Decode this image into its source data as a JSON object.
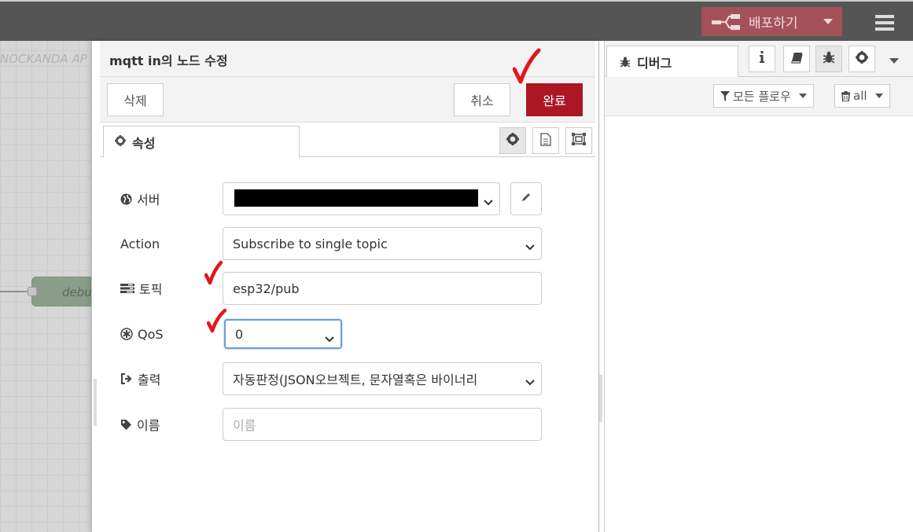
{
  "header": {
    "deploy_label": "배포하기"
  },
  "workspace": {
    "flow_tab_label": "NOCKANDA AP",
    "node_label": "debu"
  },
  "editor": {
    "title": "mqtt in의 노드 수정",
    "delete_label": "삭제",
    "cancel_label": "취소",
    "done_label": "완료",
    "tab_properties": "속성",
    "fields": {
      "server": {
        "label": "서버"
      },
      "action": {
        "label": "Action",
        "value": "Subscribe to single topic"
      },
      "topic": {
        "label": "토픽",
        "value": "esp32/pub"
      },
      "qos": {
        "label": "QoS",
        "value": "0"
      },
      "output": {
        "label": "출력",
        "value": "자동판정(JSON오브젝트, 문자열혹은 바이너리"
      },
      "name": {
        "label": "이름",
        "placeholder": "이름"
      }
    }
  },
  "sidebar": {
    "debug_tab": "디버그",
    "filter_flows": "모든 플로우",
    "clear_all": "all"
  },
  "colors": {
    "header_bg": "#555555",
    "deploy_bg": "#a3525a",
    "done_bg": "#ad1625",
    "annotation_check": "#e3161c"
  },
  "icons": [
    "deploy-icon",
    "hamburger-menu-icon",
    "cog-icon",
    "document-icon",
    "frame-icon",
    "globe-icon",
    "pencil-icon",
    "tasks-icon",
    "asterisk-icon",
    "sign-out-icon",
    "tag-icon",
    "bug-icon",
    "info-icon",
    "book-icon",
    "filter-icon",
    "trash-icon",
    "chevron-down-icon",
    "caret-down-icon",
    "checkmark-annotation"
  ]
}
